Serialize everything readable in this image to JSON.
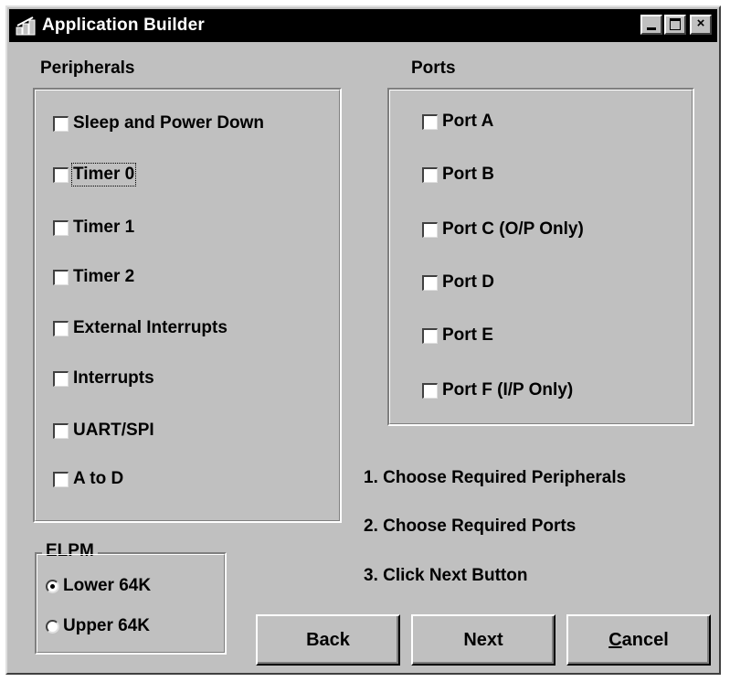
{
  "window": {
    "title": "Application Builder",
    "controls": {
      "minimize": "_",
      "maximize": "□",
      "close": "×"
    }
  },
  "peripherals": {
    "heading": "Peripherals",
    "items": [
      {
        "label": "Sleep and Power Down",
        "checked": false
      },
      {
        "label": "Timer 0",
        "checked": false
      },
      {
        "label": "Timer 1",
        "checked": false
      },
      {
        "label": "Timer 2",
        "checked": false
      },
      {
        "label": "External Interrupts",
        "checked": false
      },
      {
        "label": "Interrupts",
        "checked": false
      },
      {
        "label": "UART/SPI",
        "checked": false
      },
      {
        "label": "A to D",
        "checked": false
      }
    ]
  },
  "ports": {
    "heading": "Ports",
    "items": [
      {
        "label": "Port A",
        "checked": false
      },
      {
        "label": "Port B",
        "checked": false
      },
      {
        "label": "Port C (O/P Only)",
        "checked": false
      },
      {
        "label": "Port D",
        "checked": false
      },
      {
        "label": "Port E",
        "checked": false
      },
      {
        "label": "Port F (I/P Only)",
        "checked": false
      }
    ]
  },
  "elpm": {
    "heading": "ELPM",
    "options": [
      {
        "label": "Lower 64K",
        "selected": true
      },
      {
        "label": "Upper 64K",
        "selected": false
      }
    ]
  },
  "instructions": [
    "1.  Choose Required Peripherals",
    "2.  Choose Required Ports",
    "3.  Click Next Button"
  ],
  "buttons": {
    "back": "Back",
    "next": "Next",
    "cancel": "Cancel"
  }
}
